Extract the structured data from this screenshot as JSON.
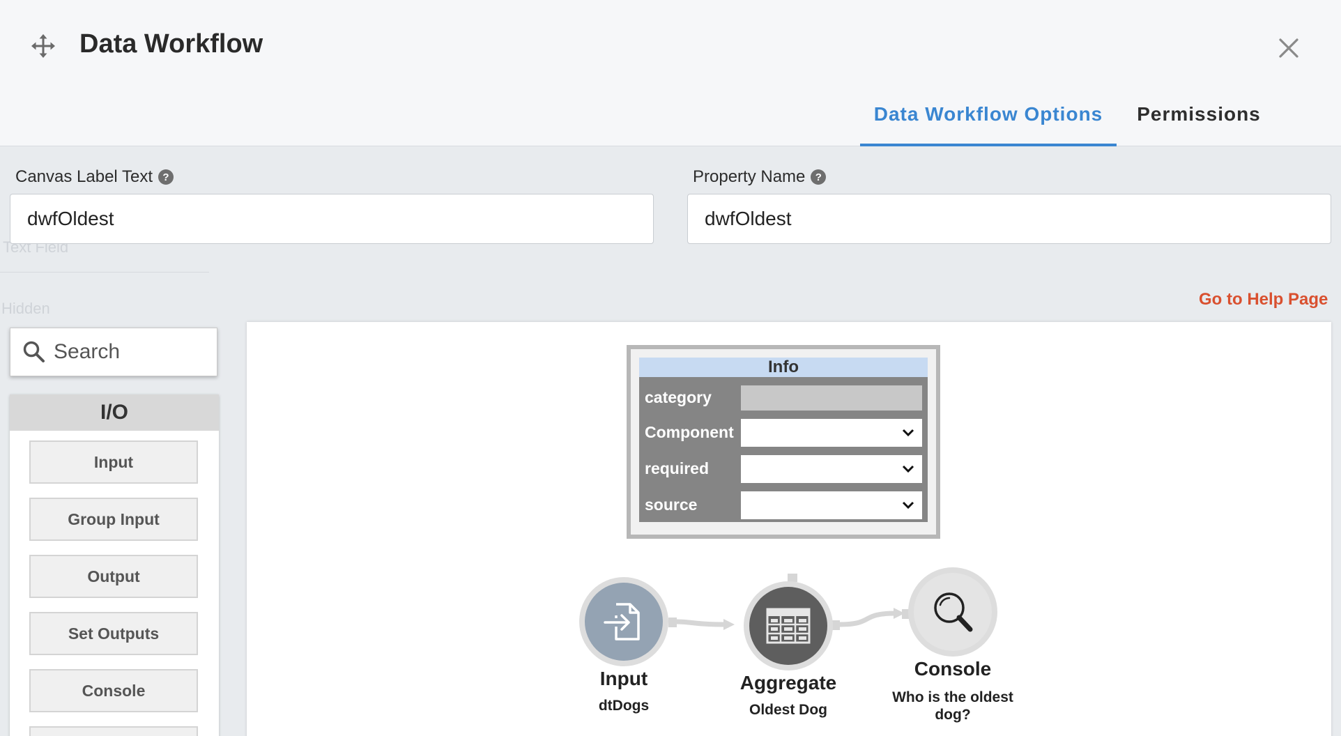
{
  "dialog": {
    "title": "Data Workflow",
    "tabs": [
      {
        "label": "Data Workflow Options",
        "active": true
      },
      {
        "label": "Permissions",
        "active": false
      }
    ]
  },
  "background": {
    "texts": [
      "Text Field",
      "Hidden"
    ]
  },
  "fields": {
    "canvas_label": {
      "label": "Canvas Label Text",
      "value": "dwfOldest"
    },
    "property_name": {
      "label": "Property Name",
      "value": "dwfOldest"
    }
  },
  "help_link": "Go to Help Page",
  "palette": {
    "search_placeholder": "Search",
    "group": "I/O",
    "items": [
      "Input",
      "Group Input",
      "Output",
      "Set Outputs",
      "Console"
    ]
  },
  "info_panel": {
    "title": "Info",
    "rows": [
      {
        "label": "category",
        "kind": "disabled"
      },
      {
        "label": "Component",
        "kind": "select"
      },
      {
        "label": "required",
        "kind": "select"
      },
      {
        "label": "source",
        "kind": "select"
      }
    ]
  },
  "workflow": {
    "nodes": [
      {
        "title": "Input",
        "subtitle": "dtDogs",
        "icon": "import-file-icon",
        "color": "#94a3b3"
      },
      {
        "title": "Aggregate",
        "subtitle": "Oldest Dog",
        "icon": "table-grid-icon",
        "color": "#5e5e5e"
      },
      {
        "title": "Console",
        "subtitle": "Who is the oldest dog?",
        "icon": "magnifier-icon",
        "color": "#e4e4e4"
      }
    ]
  },
  "colors": {
    "accent": "#3a86d1",
    "help_link": "#d9502f",
    "info_header": "#c7daf2"
  }
}
